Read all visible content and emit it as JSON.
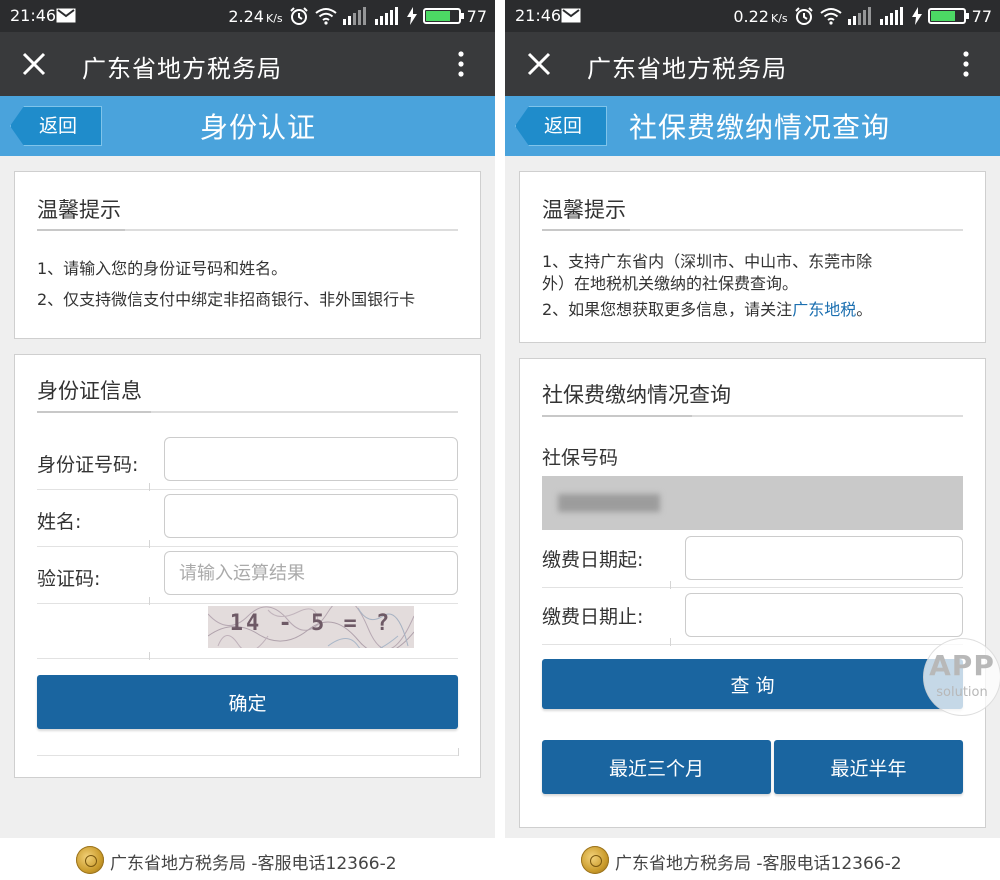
{
  "colors": {
    "status_bar": "#2b2c2e",
    "wechat_header": "#393a3c",
    "page_header": "#4aa3dc",
    "back_button": "#1f8ccb",
    "primary_button": "#1a65a0",
    "link": "#1b6fb0",
    "battery_fill": "#4cd964"
  },
  "left": {
    "status": {
      "time": "21:46",
      "speed": "2.24",
      "speed_unit": "K/s",
      "battery": "77",
      "battery_level": 0.77
    },
    "wechat": {
      "title": "广东省地方税务局",
      "close_icon": "close-icon",
      "more_icon": "more-vertical-icon"
    },
    "header": {
      "back_label": "返回",
      "title": "身份认证"
    },
    "tips": {
      "title": "温馨提示",
      "lines": [
        "1、请输入您的身份证号码和姓名。",
        "2、仅支持微信支付中绑定非招商银行、非外国银行卡"
      ]
    },
    "form": {
      "title": "身份证信息",
      "id_label": "身份证号码:",
      "id_value": "",
      "name_label": "姓名:",
      "name_value": "",
      "captcha_label": "验证码:",
      "captcha_placeholder": "请输入运算结果",
      "captcha_value": "",
      "captcha_text": "14 - 5 = ?",
      "submit_label": "确定"
    },
    "footer": {
      "text": "广东省地方税务局 -客服电话12366-2"
    }
  },
  "right": {
    "status": {
      "time": "21:46",
      "speed": "0.22",
      "speed_unit": "K/s",
      "battery": "77",
      "battery_level": 0.77
    },
    "wechat": {
      "title": "广东省地方税务局",
      "close_icon": "close-icon",
      "more_icon": "more-vertical-icon"
    },
    "header": {
      "back_label": "返回",
      "title": "社保费缴纳情况查询"
    },
    "tips": {
      "title": "温馨提示",
      "line1_a": "1、支持广东省内（深圳市、中山市、东莞市除",
      "line1_b": "外）在地税机关缴纳的社保费查询。",
      "line2_prefix": "2、如果您想获取更多信息，请关注",
      "line2_link": "广东地税",
      "line2_suffix": "。"
    },
    "query": {
      "title": "社保费缴纳情况查询",
      "ss_label": "社保号码",
      "start_label": "缴费日期起:",
      "start_value": "",
      "end_label": "缴费日期止:",
      "end_value": "",
      "query_label": "查 询",
      "quick_3m": "最近三个月",
      "quick_6m": "最近半年"
    },
    "footer": {
      "text": "广东省地方税务局 -客服电话12366-2"
    }
  },
  "watermark": {
    "line1": "APP",
    "line2": "solution"
  }
}
